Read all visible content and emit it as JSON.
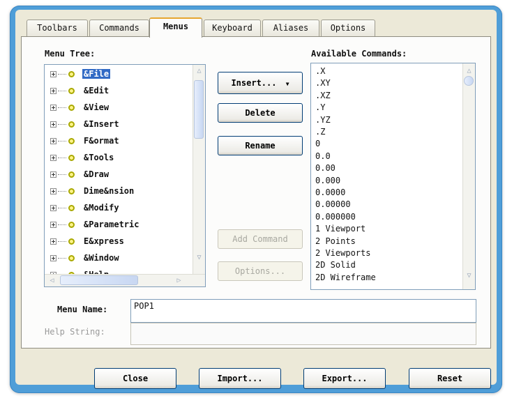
{
  "tabs": [
    "Toolbars",
    "Commands",
    "Menus",
    "Keyboard",
    "Aliases",
    "Options"
  ],
  "active_tab": "Menus",
  "menu_tree": {
    "label": "Menu Tree:",
    "items": [
      "&File",
      "&Edit",
      "&View",
      "&Insert",
      "F&ormat",
      "&Tools",
      "&Draw",
      "Dime&nsion",
      "&Modify",
      "&Parametric",
      "E&xpress",
      "&Window",
      "&Help"
    ],
    "selected": "&File"
  },
  "buttons": {
    "insert": "Insert...",
    "delete": "Delete",
    "rename": "Rename",
    "add_command": "Add Command",
    "options": "Options..."
  },
  "available_commands": {
    "label": "Available Commands:",
    "items": [
      ".X",
      ".XY",
      ".XZ",
      ".Y",
      ".YZ",
      ".Z",
      "0",
      "0.0",
      "0.00",
      "0.000",
      "0.0000",
      "0.00000",
      "0.000000",
      "1 Viewport",
      "2 Points",
      "2 Viewports",
      "2D Solid",
      "2D Wireframe"
    ]
  },
  "menu_name": {
    "label": "Menu Name:",
    "value": "POP1"
  },
  "help_string": {
    "label": "Help String:",
    "value": ""
  },
  "footer": {
    "close": "Close",
    "import": "Import...",
    "export": "Export...",
    "reset": "Reset"
  },
  "colors": {
    "frame": "#4f9ed8",
    "selection": "#316ac5",
    "active_tab_accent": "#e6a630"
  }
}
